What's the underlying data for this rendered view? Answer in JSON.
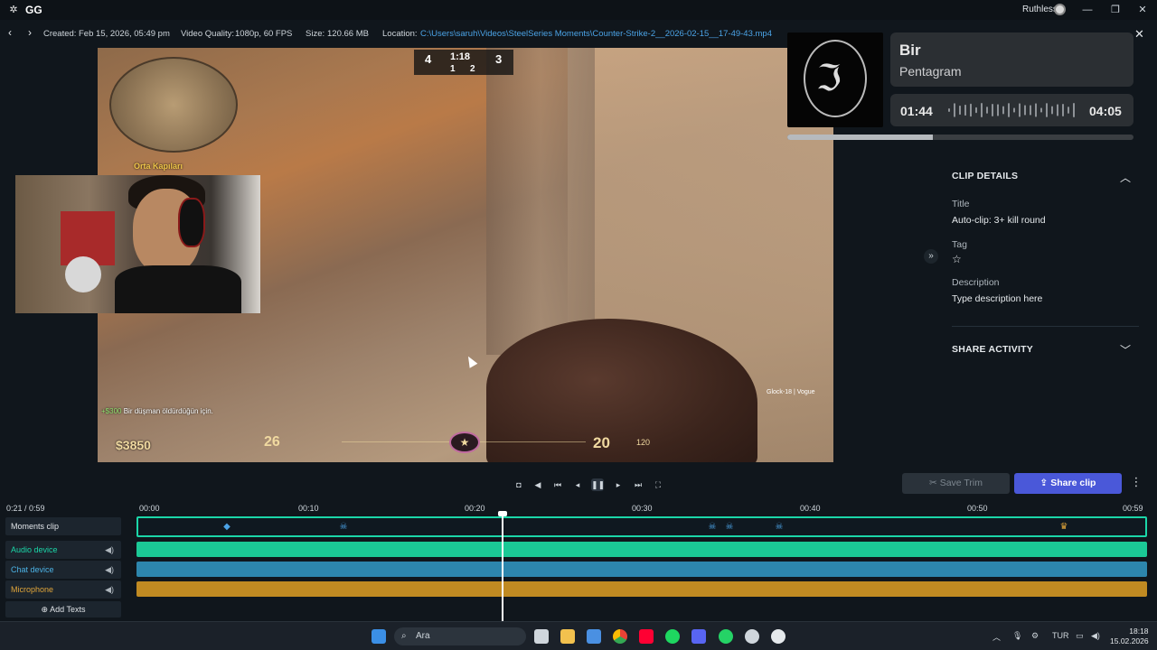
{
  "app": {
    "name": "GG",
    "user": "Ruthless"
  },
  "info": {
    "created_label": "Created:",
    "created": "Feb 15, 2026, 05:49 pm",
    "quality_label": "Video Quality:",
    "quality": "1080p, 60 FPS",
    "size_label": "Size:",
    "size": "120.66 MB",
    "location_label": "Location:",
    "location": "C:\\Users\\saruh\\Videos\\SteelSeries Moments\\Counter-Strike-2__2026-02-15__17-49-43.mp4"
  },
  "game": {
    "minimap_label": "Orta Kapıları",
    "score_left": "4",
    "score_right": "3",
    "round_time": "1:18",
    "score_sub_left": "1",
    "score_sub_right": "2",
    "money": "$3850",
    "kill_reward": "+$300",
    "kill_text": "Bir düşman öldürdüğün için.",
    "armor": "26",
    "ammo": "20",
    "ammo_reserve": "120",
    "badge": "1",
    "weapon_label": "Glock-18 | Vogue"
  },
  "now_playing": {
    "title": "Bir",
    "artist": "Pentagram",
    "current": "01:44",
    "duration": "04:05",
    "progress": 0.42
  },
  "clip_details": {
    "header": "CLIP DETAILS",
    "title_label": "Title",
    "title": "Auto-clip: 3+ kill round",
    "tag_label": "Tag",
    "description_label": "Description",
    "description_placeholder": "Type description here"
  },
  "share_activity": {
    "header": "SHARE ACTIVITY"
  },
  "actions": {
    "save_trim": "Save Trim",
    "share_clip": "Share clip"
  },
  "timeline": {
    "timecode": "0:21 / 0:59",
    "ticks": [
      "00:00",
      "00:10",
      "00:20",
      "00:30",
      "00:40",
      "00:50",
      "00:59"
    ],
    "tracks": {
      "moments": "Moments clip",
      "audio": "Audio device",
      "chat": "Chat device",
      "mic": "Microphone"
    },
    "add_texts": "Add Texts"
  },
  "taskbar": {
    "search": "Ara",
    "lang": "TUR",
    "time": "18:18",
    "date": "15.02.2026"
  },
  "colors": {
    "accent": "#4a58d9",
    "moments": "#1bd6a8",
    "audio": "#1bc996",
    "chat": "#2d86ad",
    "mic": "#c08a22"
  }
}
